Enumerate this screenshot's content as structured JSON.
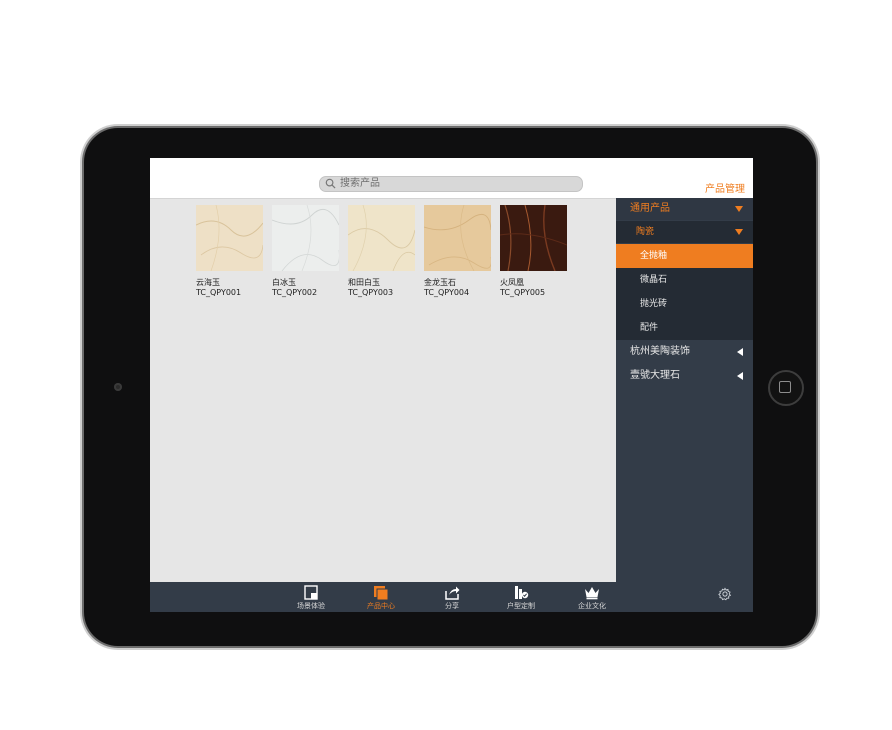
{
  "search": {
    "placeholder": "搜索产品"
  },
  "header": {
    "title": "产品管理"
  },
  "products": [
    {
      "name": "云海玉",
      "code": "TC_QPY001",
      "color": "#eee0c6"
    },
    {
      "name": "白冰玉",
      "code": "TC_QPY002",
      "color": "#eceeed"
    },
    {
      "name": "和田白玉",
      "code": "TC_QPY003",
      "color": "#efe4c9"
    },
    {
      "name": "金龙玉石",
      "code": "TC_QPY004",
      "color": "#e6c99c"
    },
    {
      "name": "火凤凰",
      "code": "TC_QPY005",
      "color": "#3a1a10"
    }
  ],
  "sidebar": {
    "general": "通用产品",
    "ceramic": "陶瓷",
    "sub_items": [
      "全抛釉",
      "微晶石",
      "抛光砖",
      "配件"
    ],
    "active_sub": "全抛釉",
    "brands": [
      "杭州美陶装饰",
      "壹號大理石"
    ]
  },
  "tabs": [
    {
      "label": "场景体验",
      "icon": "scene-icon"
    },
    {
      "label": "产品中心",
      "icon": "product-center-icon",
      "active": true
    },
    {
      "label": "分享",
      "icon": "share-icon"
    },
    {
      "label": "户型定制",
      "icon": "floorplan-icon"
    },
    {
      "label": "企业文化",
      "icon": "crown-icon"
    }
  ],
  "colors": {
    "accent": "#ef7d20",
    "sidebar": "#333c48",
    "content": "#e6e6e6"
  }
}
